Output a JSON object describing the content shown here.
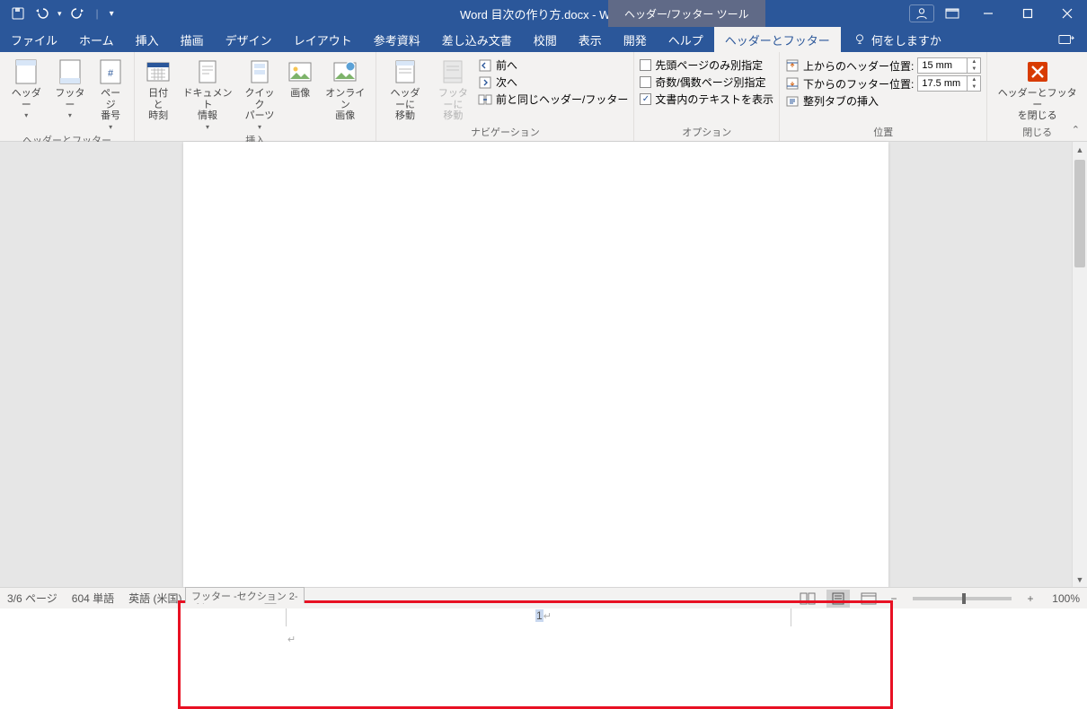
{
  "titlebar": {
    "doc_title": "Word 目次の作り方.docx - Word",
    "context_tool": "ヘッダー/フッター ツール"
  },
  "tabs": {
    "file": "ファイル",
    "home": "ホーム",
    "insert": "挿入",
    "draw": "描画",
    "design": "デザイン",
    "layout": "レイアウト",
    "references": "参考資料",
    "mailings": "差し込み文書",
    "review": "校閲",
    "view": "表示",
    "developer": "開発",
    "help": "ヘルプ",
    "hf": "ヘッダーとフッター",
    "tell_me": "何をしますか"
  },
  "ribbon": {
    "g_hf": {
      "label": "ヘッダーとフッター",
      "header": "ヘッダー",
      "footer": "フッター",
      "page_number": "ページ\n番号"
    },
    "g_insert": {
      "label": "挿入",
      "datetime": "日付と\n時刻",
      "docinfo": "ドキュメント\n情報",
      "quick": "クイック\nパーツ",
      "image": "画像",
      "online_img": "オンライン\n画像"
    },
    "g_nav": {
      "label": "ナビゲーション",
      "goto_header": "ヘッダーに\n移動",
      "goto_footer": "フッターに\n移動",
      "prev": "前へ",
      "next": "次へ",
      "link_prev": "前と同じヘッダー/フッター"
    },
    "g_options": {
      "label": "オプション",
      "first_page": "先頭ページのみ別指定",
      "odd_even": "奇数/偶数ページ別指定",
      "show_text": "文書内のテキストを表示"
    },
    "g_position": {
      "label": "位置",
      "header_from_top": "上からのヘッダー位置:",
      "footer_from_bottom": "下からのフッター位置:",
      "header_val": "15 mm",
      "footer_val": "17.5 mm",
      "align_tab": "整列タブの挿入"
    },
    "g_close": {
      "label": "閉じる",
      "close_btn": "ヘッダーとフッター\nを閉じる"
    }
  },
  "document": {
    "footer_tag": "フッター -セクション 2-",
    "page_number_shown": "1"
  },
  "statusbar": {
    "page_info": "3/6 ページ",
    "word_count": "604 単語",
    "language": "英語 (米国)",
    "insert_mode": "挿入モード",
    "zoom": "100%"
  }
}
